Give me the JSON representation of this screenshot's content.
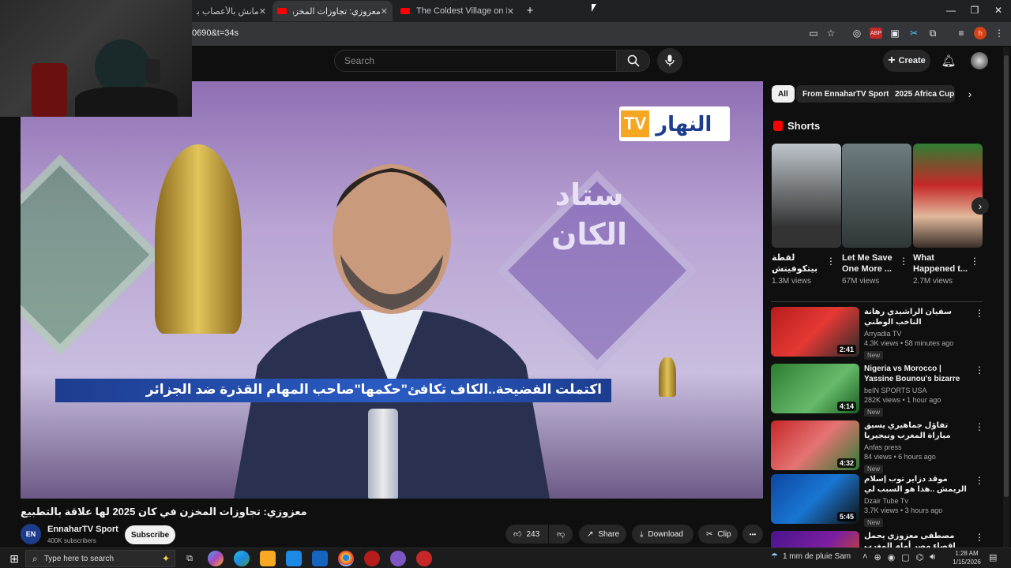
{
  "browser": {
    "tabs": [
      {
        "title": "مانش بالأعصاب بالضغط"
      },
      {
        "title": "معزوزي: تجاوزات المخزن في كان"
      },
      {
        "title": "The Coldest Village on Earth: O"
      }
    ],
    "new_tab": "+",
    "url_fragment": "0690&t=34s",
    "window_controls": [
      "—",
      "❐",
      "✕"
    ]
  },
  "youtube": {
    "search_placeholder": "Search",
    "create_label": "Create",
    "video": {
      "banner_text": "اكتملت الفضيحة..الكاف تكافئ\"حكمها\"صاحب المهام القذرة ضد الجزائر",
      "logo_text": "النهار",
      "logo_tv": "TV",
      "studio_text": "ستاد الكان",
      "title": "معزوزي: تجاوزات المخزن في كان 2025 لها علاقة بالتطبيع"
    },
    "channel": {
      "name": "EnnaharTV Sport",
      "subscribers": "400K subscribers",
      "subscribe_label": "Subscribe",
      "avatar_text": "EN"
    },
    "actions": {
      "likes": "243",
      "share": "Share",
      "download": "Download",
      "clip": "Clip",
      "more": "•••"
    }
  },
  "sidebar": {
    "chips": [
      "All",
      "From EnnaharTV Sport",
      "2025 Africa Cup o"
    ],
    "shorts_title": "Shorts",
    "shorts": [
      {
        "title": "لقطة بيتكوفيتش مع حجاج 😮 أعلق",
        "views": "1.3M views"
      },
      {
        "title": "Let Me Save One More ...",
        "views": "67M views"
      },
      {
        "title": "What Happened t...",
        "views": "2.7M views"
      }
    ],
    "recommendations": [
      {
        "title": "سفيان الراشيدي رهانة الناخب الوطني وليد_الركراكي بعد مباراة نيجيريا#",
        "channel": "Arryadia TV",
        "meta": "4.3K views • 58 minutes ago",
        "badge": "New",
        "duration": "2:41"
      },
      {
        "title": "Nigeria vs Morocco | Yassine Bounou's bizarre save in the ...",
        "channel": "beIN SPORTS USA",
        "meta": "282K views • 1 hour ago",
        "badge": "New",
        "duration": "4:14"
      },
      {
        "title": "تفاؤل جماهيري يسبق مباراة المغرب ونيجيريا",
        "channel": "Anfas press",
        "meta": "84 views • 6 hours ago",
        "badge": "New",
        "duration": "4:32"
      },
      {
        "title": "موقد دزاير توب إسلام الريمش ..هذا هو السبب لي خلاهم يحوسو خصومنا على ...",
        "channel": "Dzair Tube Tv",
        "meta": "3.7K views • 3 hours ago",
        "badge": "New",
        "duration": "5:45"
      },
      {
        "title": "مصطفى معزوزي يحمل إقصاء مصر أمام المغرب للكاف ...",
        "channel": "",
        "meta": "",
        "badge": "",
        "duration": ""
      }
    ]
  },
  "taskbar": {
    "search_placeholder": "Type here to search",
    "weather": "1 mm de pluie Sam",
    "time": "1:28 AM",
    "date": "1/15/2026"
  },
  "colors": {
    "bg": "#0f0f0f",
    "yt_red": "#ff0000",
    "chip_bg": "#272727",
    "banner_blue": "#2a5bc4"
  }
}
